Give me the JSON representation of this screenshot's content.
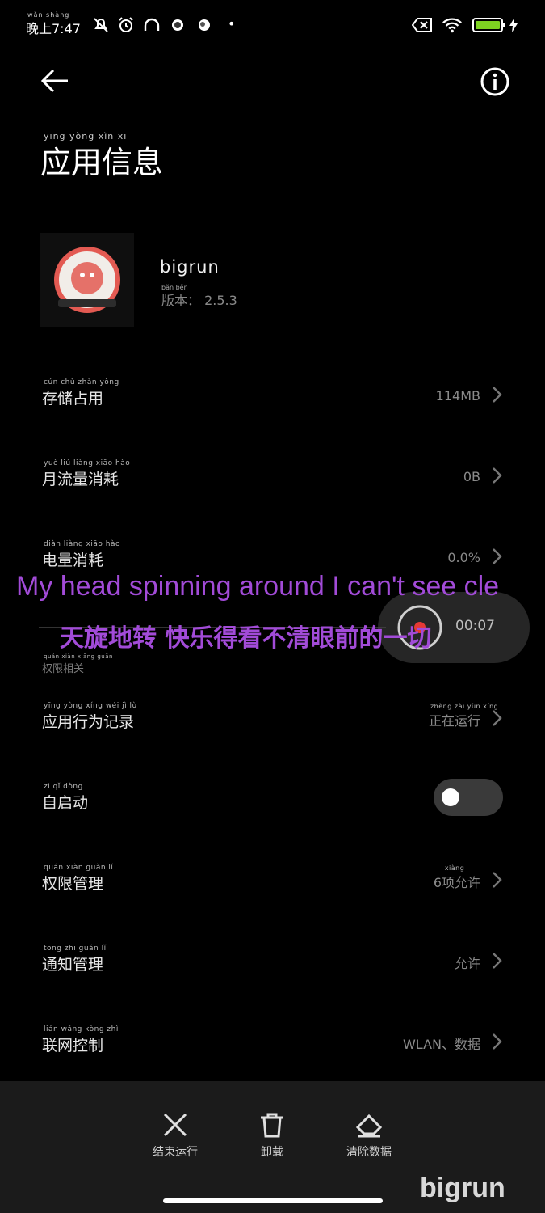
{
  "status_bar": {
    "time": "晚上7:47",
    "time_pinyin": "wǎn shàng",
    "dot": "•"
  },
  "header": {
    "title": "应用信息",
    "title_pinyin": "yīng  yòng  xìn  xī"
  },
  "app": {
    "name": "bigrun",
    "version": "版本： 2.5.3",
    "version_pinyin": "bǎn  běn"
  },
  "rows": [
    {
      "label": "存储占用",
      "pinyin": "cún chǔ zhàn yòng",
      "value": "114MB"
    },
    {
      "label": "月流量消耗",
      "pinyin": "yuè liú liàng xiāo hào",
      "value": "0B"
    },
    {
      "label": "电量消耗",
      "pinyin": "diàn liàng xiāo hào",
      "value": "0.0%"
    }
  ],
  "floating_value": "00:07",
  "section": {
    "title": "权限相关",
    "pinyin": "quán xiàn xiāng guān"
  },
  "perm_rows": [
    {
      "label": "应用行为记录",
      "pinyin": "yīng yòng xíng wéi jì lù",
      "value": "正在运行",
      "value_pinyin": "zhèng zài yùn xíng"
    },
    {
      "label": "自启动",
      "pinyin": "zì  qǐ  dòng",
      "toggle": false
    },
    {
      "label": "权限管理",
      "pinyin": "quán xiàn guǎn lǐ",
      "value": "6项允许",
      "value_pinyin": "xiàng"
    },
    {
      "label": "通知管理",
      "pinyin": "tōng zhī guǎn lǐ",
      "value": "允许"
    },
    {
      "label": "联网控制",
      "pinyin": "lián wǎng kòng zhì",
      "value": "WLAN、数据"
    }
  ],
  "lyrics": {
    "line1": "My head spinning around I can't see cle",
    "line2": "天旋地转 快乐得看不清眼前的一切"
  },
  "bottom_actions": [
    {
      "label": "结束运行",
      "icon": "close-icon"
    },
    {
      "label": "卸载",
      "icon": "trash-icon"
    },
    {
      "label": "清除数据",
      "icon": "eraser-icon"
    }
  ],
  "watermark": "bigrun"
}
